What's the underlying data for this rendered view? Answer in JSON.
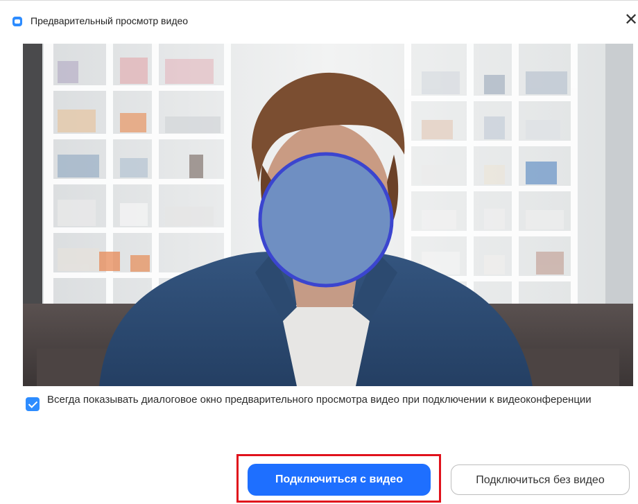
{
  "window": {
    "title": "Предварительный просмотр видео",
    "close_symbol": "✕",
    "app_icon": "zoom-camera-icon"
  },
  "video_preview": {
    "content": "webcam feed of a man in a denim shirt in front of a white bookshelf; face covered by a blue circle"
  },
  "options": {
    "always_show_preview_label": "Всегда показывать диалоговое окно предварительного просмотра видео при подключении к видеоконференции",
    "always_show_preview_checked": true
  },
  "buttons": {
    "join_with_video": "Подключиться с видео",
    "join_without_video": "Подключиться без видео"
  },
  "colors": {
    "accent": "#1e6fff",
    "checkbox": "#2d8cff",
    "highlight_frame": "#e0121c",
    "face_mask_fill": "#6f8fc2",
    "face_mask_stroke": "#3b45cf"
  }
}
